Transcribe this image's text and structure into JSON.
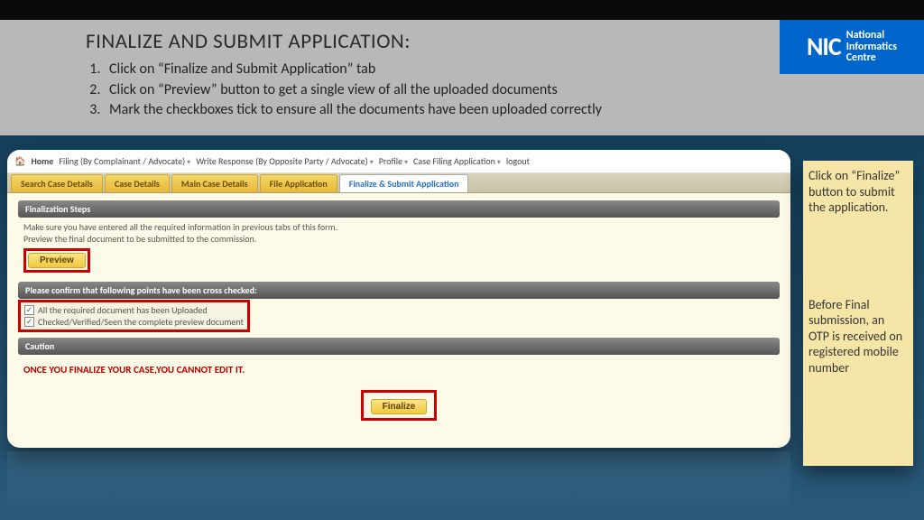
{
  "logo": {
    "big": "NIC",
    "line1": "National",
    "line2": "Informatics",
    "line3": "Centre"
  },
  "title": "FINALIZE AND SUBMIT APPLICATION:",
  "steps": [
    "Click on “Finalize and Submit Application” tab",
    "Click on “Preview” button to get a single view of all the uploaded documents",
    "Mark the checkboxes tick to ensure all  the documents have been uploaded correctly"
  ],
  "crumbs": {
    "home": "Home",
    "items": [
      "Filing (By Complainant / Advocate)",
      "Write Response (By Opposite Party / Advocate)",
      "Profile",
      "Case Filing Application"
    ],
    "logout": "logout"
  },
  "tabs": [
    "Search Case Details",
    "Case Details",
    "Main Case Details",
    "File Application",
    "Finalize & Submit Application"
  ],
  "finalization": {
    "header": "Finalization Steps",
    "line1": "Make sure you have entered all the required information in previous tabs of this form.",
    "line2": "Preview the final document to be submitted to the commission.",
    "preview": "Preview"
  },
  "confirm": {
    "header": "Please confirm that following points have been cross checked:",
    "c1": "All the required document has been Uploaded",
    "c2": "Checked/Verified/Seen the complete preview document"
  },
  "caution": {
    "header": "Caution",
    "text": "ONCE YOU FINALIZE YOUR CASE,YOU CANNOT EDIT IT."
  },
  "finalize": "Finalize",
  "note": {
    "p1": "Click on “Finalize” button to submit the application.",
    "p2": "Before Final submission, an OTP is received on registered mobile number"
  }
}
